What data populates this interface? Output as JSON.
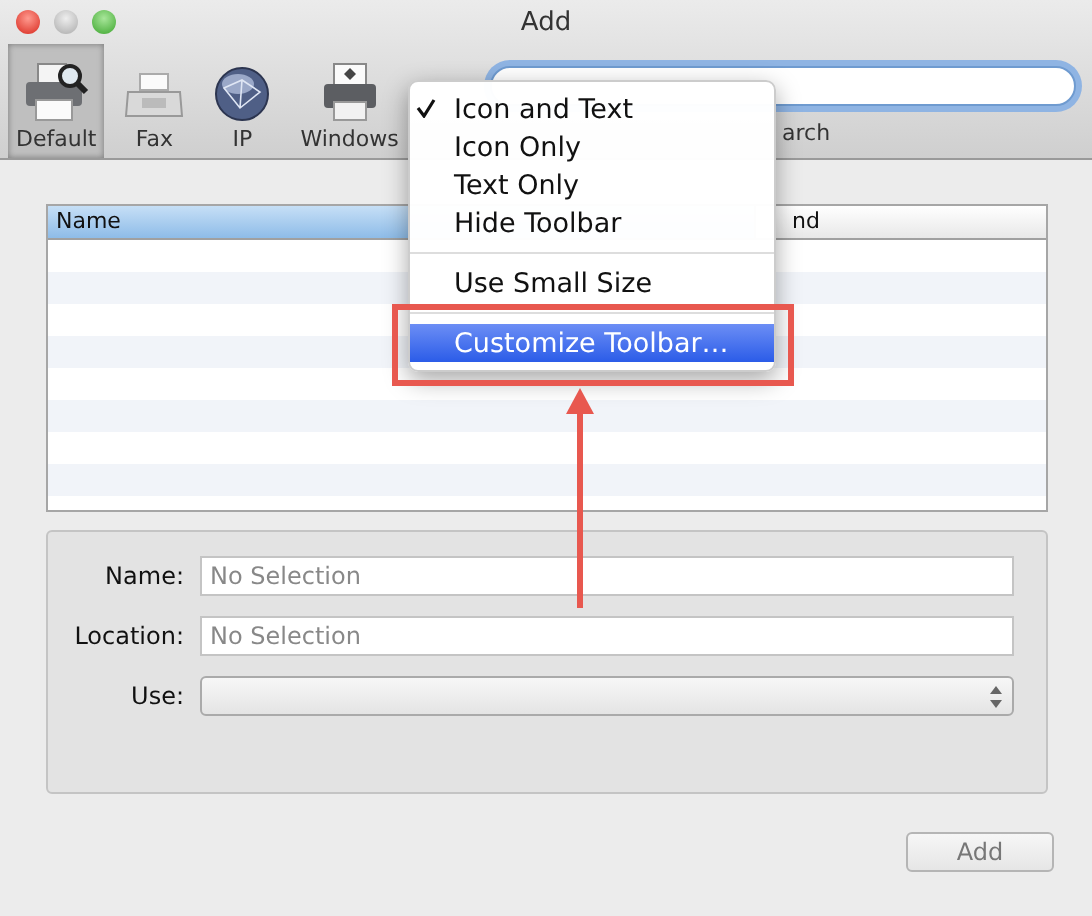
{
  "window": {
    "title": "Add"
  },
  "toolbar": {
    "items": [
      {
        "label": "Default",
        "kind": "printer-search",
        "selected": true
      },
      {
        "label": "Fax",
        "kind": "fax",
        "selected": false
      },
      {
        "label": "IP",
        "kind": "globe",
        "selected": false
      },
      {
        "label": "Windows",
        "kind": "printer-windows",
        "selected": false
      }
    ],
    "search": {
      "label": "arch"
    }
  },
  "table": {
    "columns": [
      {
        "label": "Name",
        "selected": true
      },
      {
        "label": "nd",
        "selected": false
      }
    ]
  },
  "form": {
    "fields": [
      {
        "label": "Name:",
        "kind": "text",
        "placeholder": "No Selection"
      },
      {
        "label": "Location:",
        "kind": "text",
        "placeholder": "No Selection"
      },
      {
        "label": "Use:",
        "kind": "popup"
      }
    ]
  },
  "buttons": [
    {
      "label": "Add",
      "disabled": true
    }
  ],
  "context_menu": {
    "items": [
      {
        "kind": "item",
        "label": "Icon and Text",
        "checked": true,
        "selected": false
      },
      {
        "kind": "item",
        "label": "Icon Only",
        "checked": false,
        "selected": false
      },
      {
        "kind": "item",
        "label": "Text Only",
        "checked": false,
        "selected": false
      },
      {
        "kind": "item",
        "label": "Hide Toolbar",
        "checked": false,
        "selected": false
      },
      {
        "kind": "separator"
      },
      {
        "kind": "item",
        "label": "Use Small Size",
        "checked": false,
        "selected": false
      },
      {
        "kind": "separator"
      },
      {
        "kind": "item",
        "label": "Customize Toolbar…",
        "checked": false,
        "selected": true
      }
    ]
  }
}
